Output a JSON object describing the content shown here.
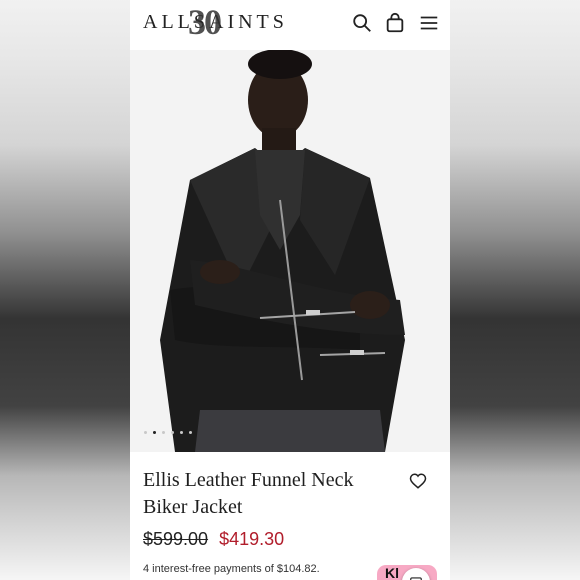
{
  "brand": {
    "logo_text": "ALLSAINTS",
    "badge_text": "30"
  },
  "header": {
    "icons": {
      "search": "search-icon",
      "bag": "bag-icon",
      "menu": "menu-icon"
    }
  },
  "gallery": {
    "slide_count": 6,
    "active_index": 1
  },
  "product": {
    "title": "Ellis Leather Funnel Neck Biker Jacket",
    "original_price": "$599.00",
    "sale_price": "$419.30",
    "payment_text": "4 interest-free payments of $104.82.",
    "klarna_text": "Kl"
  },
  "colors": {
    "sale": "#b11d2b",
    "klarna": "#f7a9c4",
    "text": "#1f1f1f"
  }
}
